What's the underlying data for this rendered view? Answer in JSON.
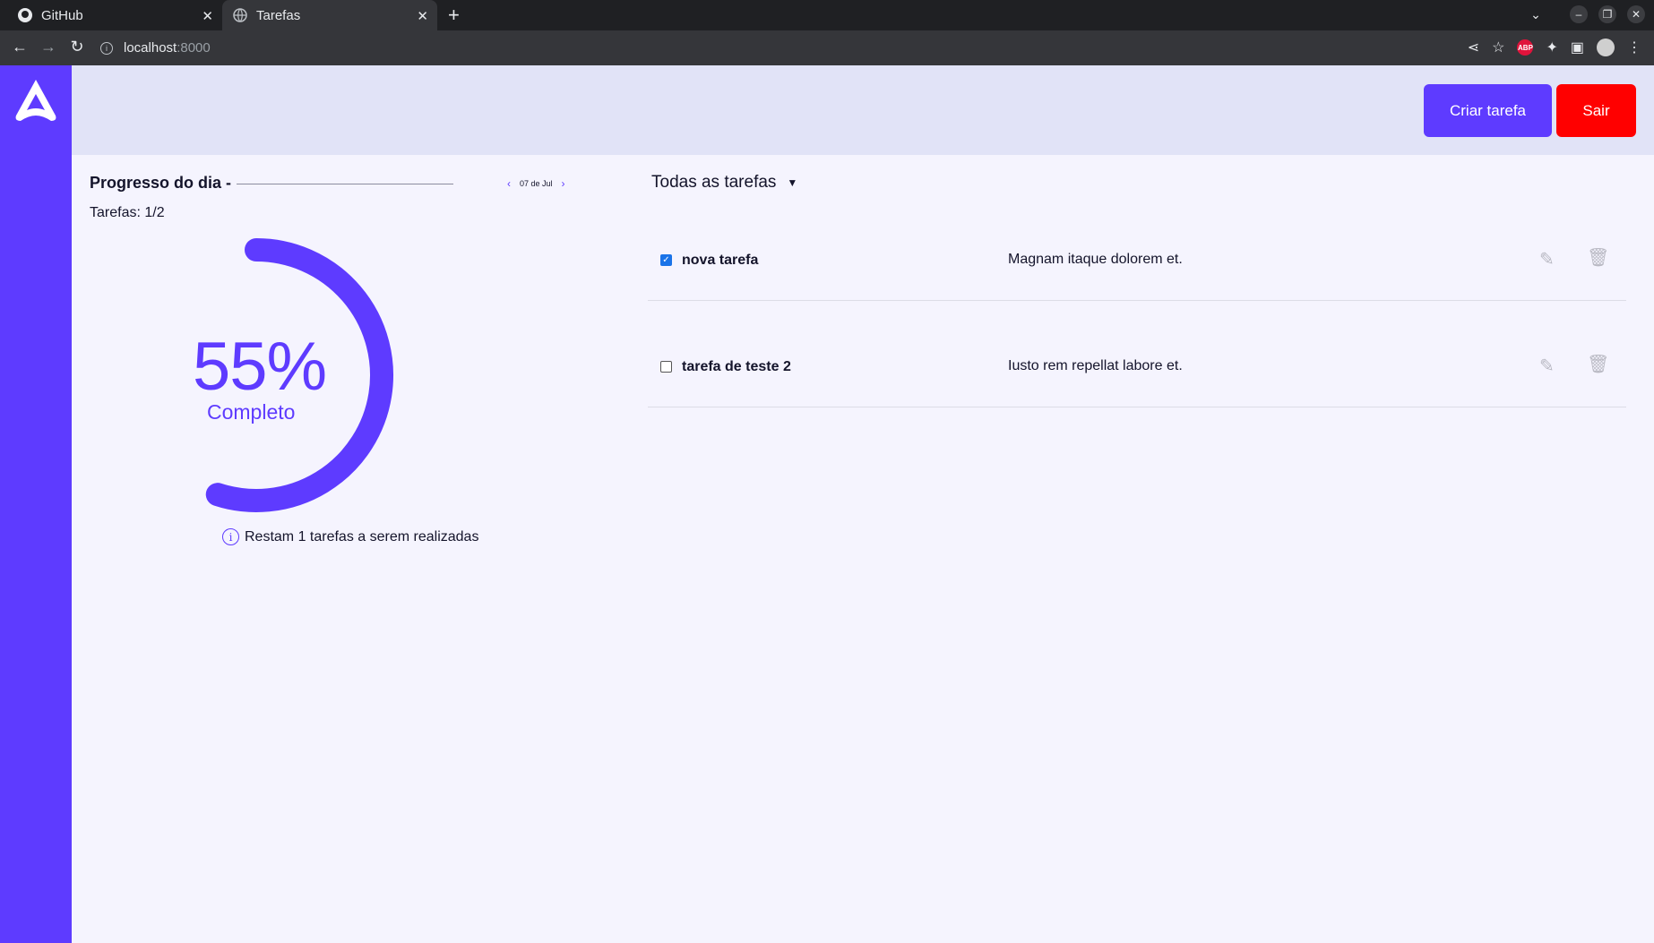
{
  "browser": {
    "tabs": [
      {
        "title": "GitHub"
      },
      {
        "title": "Tarefas"
      }
    ],
    "url_host": "localhost",
    "url_port": ":8000"
  },
  "header": {
    "create_label": "Criar tarefa",
    "exit_label": "Sair"
  },
  "progress": {
    "title": "Progresso do dia -",
    "date": "07 de Jul",
    "tasks_label": "Tarefas: 1/2",
    "percent_label": "55%",
    "percent_value": 55,
    "complete_label": "Completo",
    "remaining_text": "Restam 1 tarefas a serem realizadas"
  },
  "filter": {
    "selected": "Todas as tarefas"
  },
  "tasks": [
    {
      "title": "nova tarefa",
      "description": "Magnam itaque dolorem et.",
      "done": true
    },
    {
      "title": "tarefa de teste 2",
      "description": "Iusto rem repellat labore et.",
      "done": false
    }
  ],
  "colors": {
    "primary": "#5e3bff",
    "danger": "#ff0000",
    "topbar": "#e1e3f7",
    "background": "#f5f4fe"
  }
}
